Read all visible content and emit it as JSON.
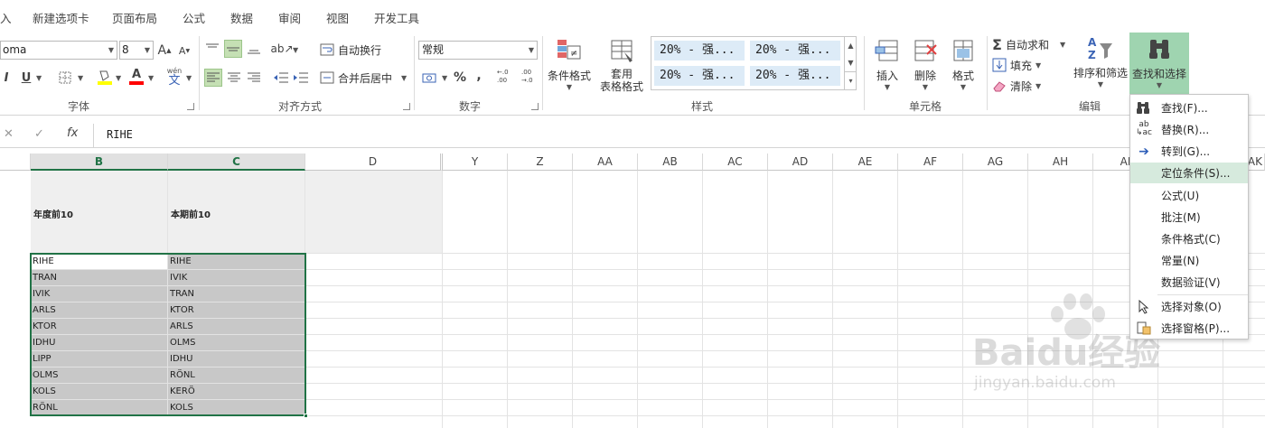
{
  "tabs": [
    "入",
    "新建选项卡",
    "页面布局",
    "公式",
    "数据",
    "审阅",
    "视图",
    "开发工具"
  ],
  "font": {
    "name": "oma",
    "size": "8",
    "grow": "A",
    "shrink": "A",
    "bold": "I",
    "underline": "U",
    "fill_letter": "A",
    "wen": "wén",
    "wen_char": "文"
  },
  "groups": {
    "font": "字体",
    "align": "对齐方式",
    "number": "数字",
    "styles": "样式",
    "cells": "单元格",
    "edit": "编辑"
  },
  "align": {
    "wrap": "自动换行",
    "merge": "合并后居中"
  },
  "number": {
    "format": "常规",
    "percent": "%",
    "comma": ",",
    "inc": "←.0 .00",
    "dec": ".00 →.0"
  },
  "styles": {
    "cond_format": "条件格式",
    "table_format_1": "套用",
    "table_format_2": "表格格式",
    "cells": [
      "20% - 强...",
      "20% - 强...",
      "20% - 强...",
      "20% - 强..."
    ]
  },
  "cells_group": {
    "insert": "插入",
    "delete": "删除",
    "format": "格式"
  },
  "edit": {
    "autosum": "自动求和",
    "fill": "填充",
    "clear": "清除",
    "sort": "排序和筛选",
    "find": "查找和选择",
    "sigma": "Σ",
    "az_a": "A",
    "az_z": "Z"
  },
  "formula_bar": {
    "cancel": "✕",
    "confirm": "✓",
    "fx": "fx",
    "value": "RIHE"
  },
  "columns": [
    "B",
    "C",
    "D",
    "Y",
    "Z",
    "AA",
    "AB",
    "AC",
    "AD",
    "AE",
    "AF",
    "AG",
    "AH",
    "AI",
    "AK"
  ],
  "headers": {
    "b": "年度前10",
    "c": "本期前10"
  },
  "col_b": [
    "RIHE",
    "TRAN",
    "IVIK",
    "ARLS",
    "KTOR",
    "IDHU",
    "LIPP",
    "OLMS",
    "KOLS",
    "RÖNL"
  ],
  "col_c": [
    "RIHE",
    "IVIK",
    "TRAN",
    "KTOR",
    "ARLS",
    "OLMS",
    "IDHU",
    "RÖNL",
    "KERÖ",
    "KOLS"
  ],
  "menu": [
    {
      "label": "查找(F)...",
      "icon": "binoculars-icon"
    },
    {
      "label": "替换(R)...",
      "icon": "replace-icon"
    },
    {
      "label": "转到(G)...",
      "icon": "arrow-right-icon"
    },
    {
      "label": "定位条件(S)...",
      "icon": ""
    },
    {
      "label": "公式(U)",
      "icon": ""
    },
    {
      "label": "批注(M)",
      "icon": ""
    },
    {
      "label": "条件格式(C)",
      "icon": ""
    },
    {
      "label": "常量(N)",
      "icon": ""
    },
    {
      "label": "数据验证(V)",
      "icon": ""
    },
    {
      "label": "选择对象(O)",
      "icon": "cursor-icon"
    },
    {
      "label": "选择窗格(P)...",
      "icon": "pane-icon"
    }
  ],
  "watermark": {
    "main": "Baidu经验",
    "sub": "jingyan.baidu.com"
  },
  "colors": {
    "accent": "#217346",
    "selection": "#c8c8c8",
    "style_cell": "#ddebf7",
    "menu_highlight": "#d6eadd"
  }
}
